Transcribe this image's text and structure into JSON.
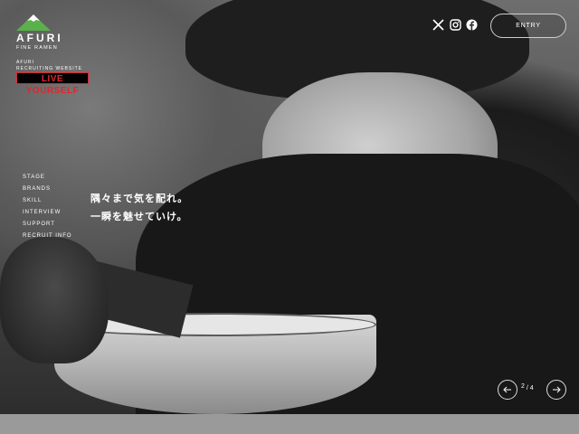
{
  "brand": {
    "name": "AFURI",
    "subtitle": "FINE RAMEN",
    "recruit_line1": "AFURI",
    "recruit_line2": "RECRUITING WEBSITE",
    "tagline": "LIVE YOURSELF",
    "logo_icon": "mountain-logo-icon",
    "accent_color": "#e0262c",
    "logo_color": "#5ab04a"
  },
  "header": {
    "social": [
      {
        "name": "x-icon"
      },
      {
        "name": "instagram-icon"
      },
      {
        "name": "facebook-icon"
      }
    ],
    "entry_label": "ENTRY"
  },
  "nav": {
    "items": [
      "STAGE",
      "BRANDS",
      "SKILL",
      "INTERVIEW",
      "SUPPORT",
      "RECRUIT INFO"
    ]
  },
  "hero": {
    "catch_line1": "隅々まで気を配れ。",
    "catch_line2": "一瞬を魅せていけ。"
  },
  "slider": {
    "current": "2",
    "separator": "/",
    "total": "4",
    "prev_icon": "arrow-left-icon",
    "next_icon": "arrow-right-icon"
  }
}
